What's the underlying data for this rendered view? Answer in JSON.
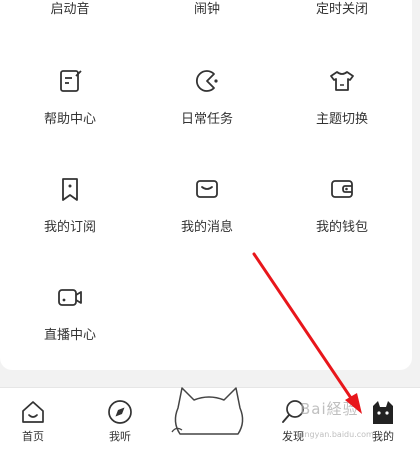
{
  "menu": {
    "row0": [
      "启动音",
      "闹钟",
      "定时关闭"
    ],
    "row1": [
      "帮助中心",
      "日常任务",
      "主题切换"
    ],
    "row2": [
      "我的订阅",
      "我的消息",
      "我的钱包"
    ],
    "row3": [
      "直播中心"
    ]
  },
  "tabbar": {
    "home": "首页",
    "listen": "我听",
    "discover": "发现",
    "mine": "我的"
  },
  "watermark": {
    "text": "Bai経验",
    "sub": "jingyan.baidu.com"
  },
  "colors": {
    "annotation_arrow": "#e8161b",
    "icon_stroke": "#333333",
    "tab_active": "#333333"
  }
}
